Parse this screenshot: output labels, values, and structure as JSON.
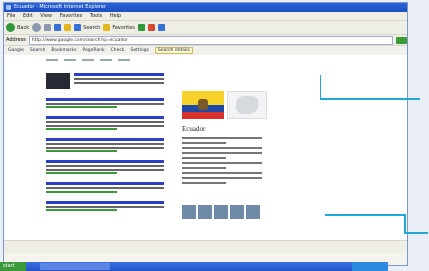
{
  "window": {
    "title": "Ecuador - Microsoft Internet Explorer"
  },
  "menu": [
    "File",
    "Edit",
    "View",
    "Favorites",
    "Tools",
    "Help"
  ],
  "toolbar": {
    "back_label": "Back",
    "search_label": "Search",
    "favorites_label": "Favorites"
  },
  "address": {
    "label": "Address",
    "value": "http://www.google.com/search?q=ecuador"
  },
  "links_bar": [
    "Google",
    "Search",
    "Bookmarks",
    "PageRank",
    "Check",
    "Settings"
  ],
  "highlight_chip": "Search details",
  "knowledge_panel": {
    "title": "Ecuador"
  },
  "taskbar": {
    "start_label": "start"
  },
  "colors": {
    "callout": "#1ea7d8",
    "titlebar": "#2a62d8"
  }
}
